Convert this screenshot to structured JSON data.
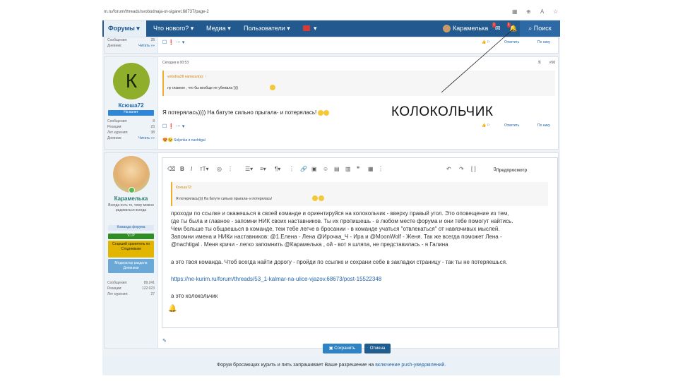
{
  "browser": {
    "url": "m.ru/forum/threads/svobodnaja-ot-sigaret.68737/page-2"
  },
  "nav": {
    "forums": "Форумы",
    "whats_new": "Что нового?",
    "media": "Медиа",
    "users": "Пользователи",
    "username": "Карамелька",
    "inbox_count": "1",
    "alerts_count": "1",
    "search": "Поиск"
  },
  "prev_post": {
    "stat_reactions_label": "Сообщения:",
    "stat_reactions_value": "28",
    "diary_label": "Дневник:",
    "diary_link": "Читать »»",
    "reply": "Ответить",
    "quote": "По нику"
  },
  "post1": {
    "time": "Сегодня в 00:53",
    "post_number": "#90",
    "avatar_letter": "К",
    "username": "Ксюша72",
    "badge": "На взлет",
    "stats": [
      {
        "label": "Сообщения:",
        "value": "8"
      },
      {
        "label": "Реакции:",
        "value": "23"
      },
      {
        "label": "Лет курения:",
        "value": "38"
      },
      {
        "label": "Дневник:",
        "value": "Читать »»"
      }
    ],
    "quote_author": "votodna28 написал(а): ↑",
    "quote_text": "ну главное , что бы вообще не убежала ))))",
    "message": "Я потерялась)))) На батуте сильно прыгала- и потерялась!",
    "reply": "Ответить",
    "quote": "По нику",
    "reactions_text": "Soljenka и nachtigal"
  },
  "annotation": "КОЛОКОЛЬЧИК",
  "post2": {
    "username": "Карамелька",
    "user_title": "Всегда есть то, чему можно радоваться всегда",
    "team_label": "Команда форума",
    "vip": "V.I.P",
    "rank": "Старший хранитель по Стодневкам",
    "moderator": "Модератор раздела Дневники",
    "stats": [
      {
        "label": "Сообщения:",
        "value": "89.241"
      },
      {
        "label": "Реакции:",
        "value": "122.023"
      },
      {
        "label": "Лет курения:",
        "value": "27"
      }
    ],
    "preview": "Предпросмотр",
    "quote_author": "Ксюша72:",
    "quote_text": "Я потерялась)))) На батуте сильно прыгала- и потерялась!",
    "body_lines": [
      "проходи по ссылке и окажешься в своей команде и ориентируйся на колокольчик - вверху правый угол. Это оповещение из тем,",
      "где ты была и главное - запомни НИК своих наставников. Ты их пропишешь - в любом месте форума и они тебе помогут найтись.",
      "Чем больше ты общаешься в команде, тем тебе легче в бросании - в команде учаться \"отвлекаться\" от навязчивых мыслей.",
      "Запомни имена и НИКи наставников: @1.Елена - Лена  @Ирочка_Ч  - Ира и @MoonWolf - Женя. Так же всегда поможет Лена -",
      "@nachtigal . Меня кричи - легко запомнить @Карамелька , ой - вот я шляпа, не представилась - я Галина"
    ],
    "line_team": "а это твоя команда. Чтоб всегда найти дорогу - пройди по ссылке и сохрани себе в закладки страницу - так ты не потеряешься.",
    "link": "https://ne-kurim.ru/forum/threads/53_1-kalmar-na-ulice-vjazov.68673/post-15522348",
    "line_bell": "а это колокольчик",
    "save": "Сохранить",
    "cancel": "Отмена"
  },
  "footer": {
    "text": "Форум бросающих курить и пить запрашивает Ваше разрешение на",
    "link": "включение push-уведомлений."
  }
}
